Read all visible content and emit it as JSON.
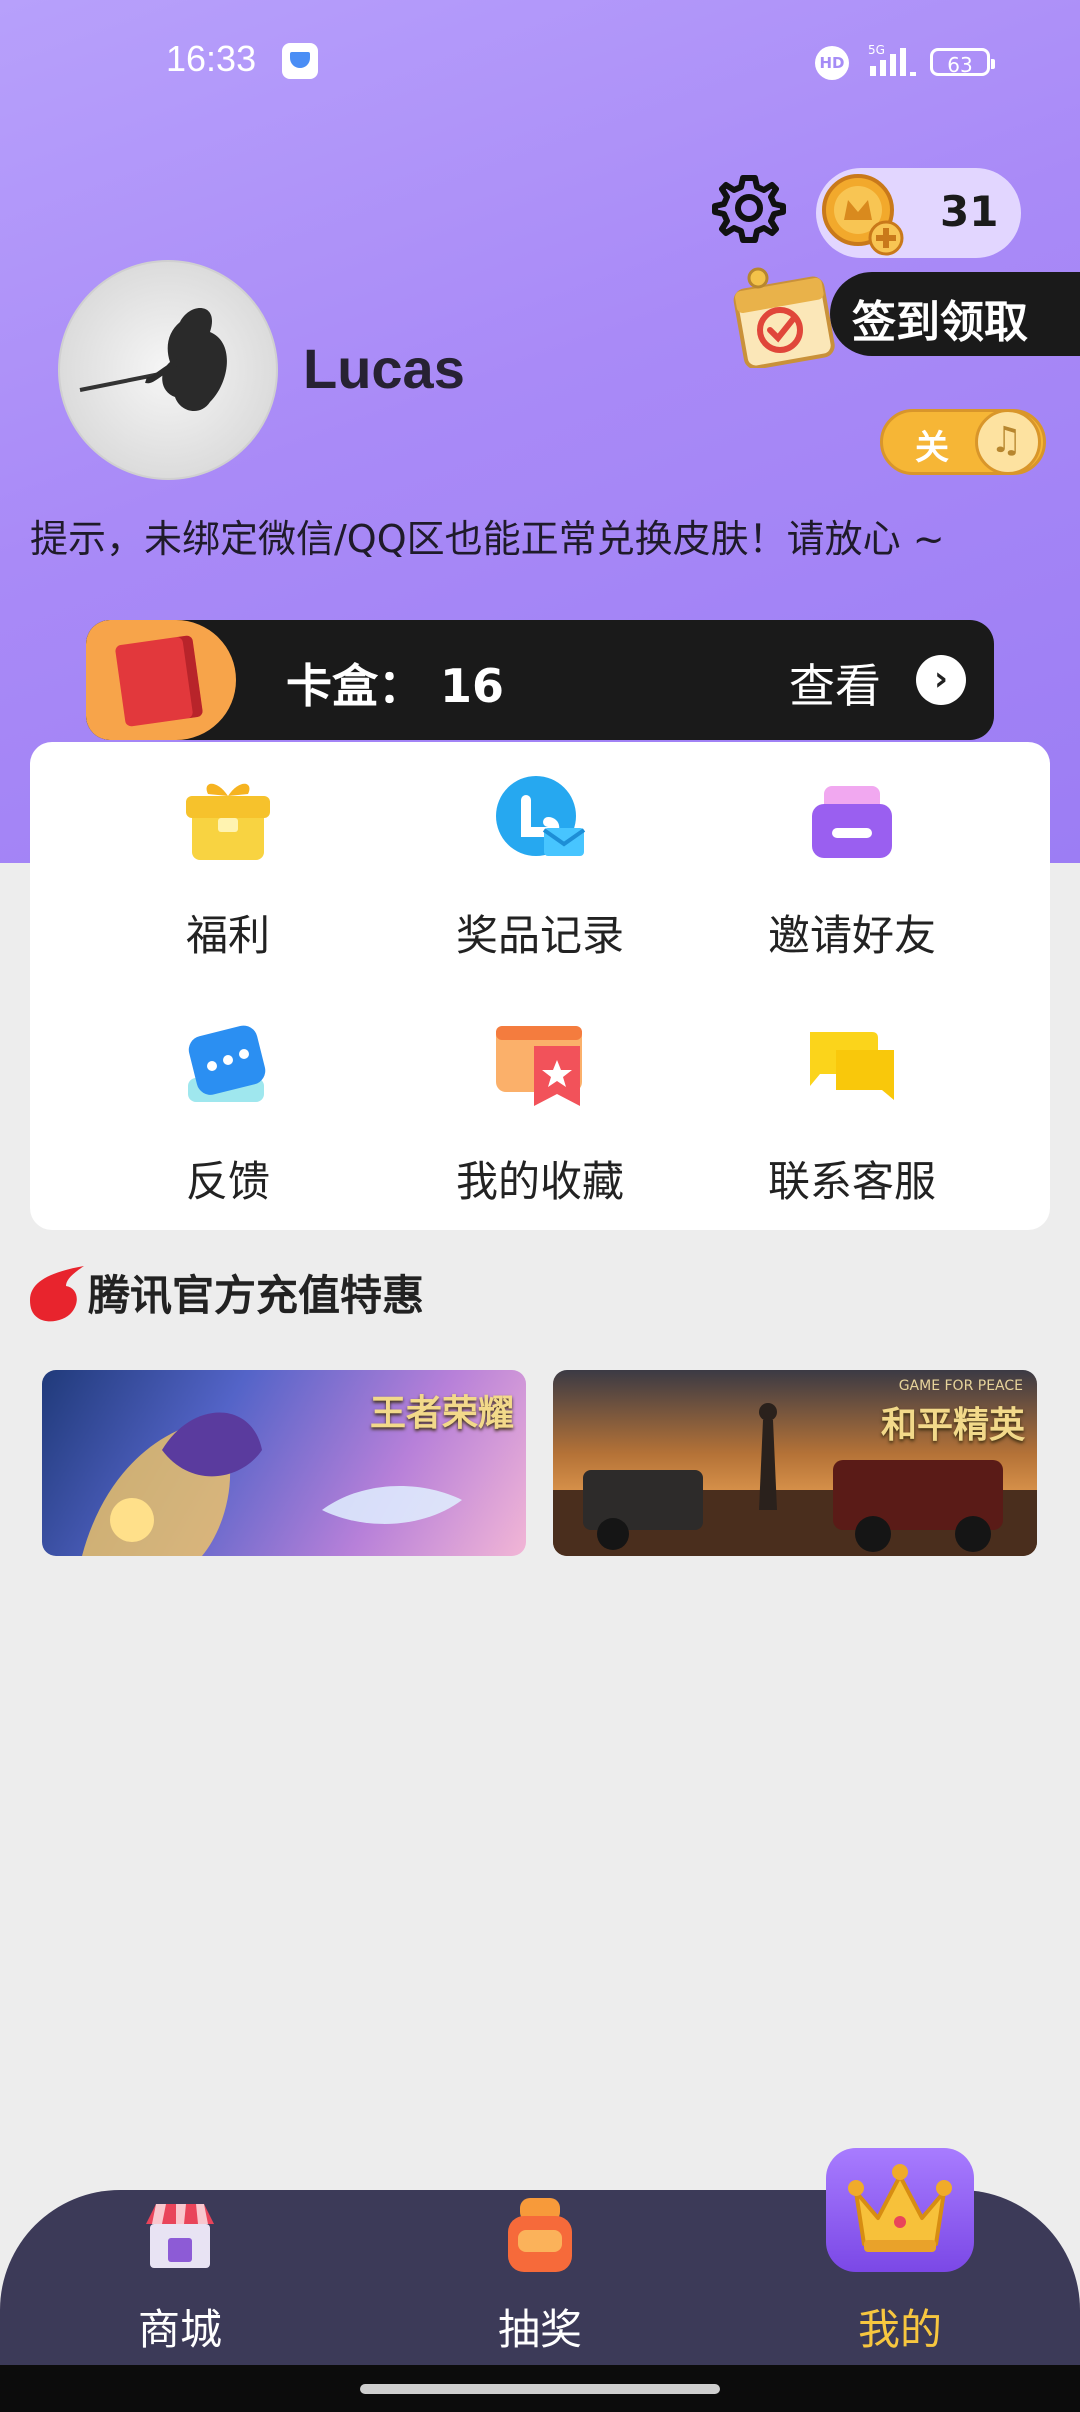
{
  "status_bar": {
    "time": "16:33",
    "network": "5G",
    "hd": "HD",
    "battery": "63"
  },
  "header": {
    "coin_count": "31",
    "checkin_label": "签到领取",
    "username": "Lucas",
    "music_toggle_label": "关",
    "tip": "提示，未绑定微信/QQ区也能正常兑换皮肤！请放心 ~"
  },
  "cardbox": {
    "label": "卡盒：",
    "count": "16",
    "view_label": "查看",
    "arrow": "›"
  },
  "menu": {
    "items": [
      {
        "label": "福利",
        "icon": "gift-icon"
      },
      {
        "label": "奖品记录",
        "icon": "prize-record-icon"
      },
      {
        "label": "邀请好友",
        "icon": "invite-friend-icon"
      },
      {
        "label": "反馈",
        "icon": "feedback-icon"
      },
      {
        "label": "我的收藏",
        "icon": "favorites-icon"
      },
      {
        "label": "联系客服",
        "icon": "customer-service-icon"
      }
    ]
  },
  "promo": {
    "title": "腾讯官方充值特惠",
    "banners": [
      {
        "title": "王者荣耀",
        "icon": "honor-of-kings-banner"
      },
      {
        "title": "和平精英",
        "subtitle": "GAME FOR PEACE",
        "icon": "game-for-peace-banner"
      }
    ]
  },
  "bottom_nav": {
    "items": [
      {
        "label": "商城",
        "icon": "shop-icon"
      },
      {
        "label": "抽奖",
        "icon": "lottery-icon"
      },
      {
        "label": "我的",
        "icon": "crown-icon",
        "active": true
      }
    ]
  },
  "colors": {
    "hero_purple": "#a98af7",
    "accent_yellow": "#f7c63f",
    "nav_bg": "#3c3a58",
    "card_dark": "#1a1a1a"
  }
}
